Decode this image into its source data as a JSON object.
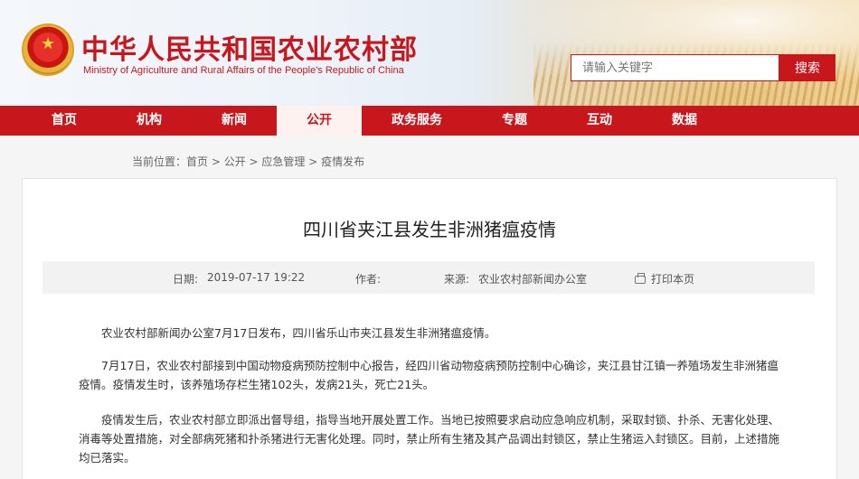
{
  "header": {
    "site_title": "中华人民共和国农业农村部",
    "site_subtitle": "Ministry of Agriculture and Rural Affairs of the People's Republic of China",
    "search_placeholder": "请输入关键字",
    "search_button": "搜索"
  },
  "nav": {
    "items": [
      {
        "label": "首页"
      },
      {
        "label": "机构"
      },
      {
        "label": "新闻"
      },
      {
        "label": "公开"
      },
      {
        "label": "政务服务"
      },
      {
        "label": "专题"
      },
      {
        "label": "互动"
      },
      {
        "label": "数据"
      }
    ],
    "active_index": 3
  },
  "breadcrumb": {
    "prefix": "当前位置：",
    "items": [
      "首页",
      "公开",
      "应急管理",
      "疫情发布"
    ],
    "separator": " > "
  },
  "article": {
    "title": "四川省夹江县发生非洲猪瘟疫情",
    "date_label": "日期:",
    "date": "2019-07-17 19:22",
    "author_label": "作者:",
    "author": "",
    "source_label": "来源:",
    "source": "农业农村部新闻办公室",
    "print_label": "打印本页",
    "paragraphs": [
      "农业农村部新闻办公室7月17日发布，四川省乐山市夹江县发生非洲猪瘟疫情。",
      "7月17日，农业农村部接到中国动物疫病预防控制中心报告，经四川省动物疫病预防控制中心确诊，夹江县甘江镇一养殖场发生非洲猪瘟疫情。疫情发生时，该养殖场存栏生猪102头，发病21头，死亡21头。",
      "疫情发生后，农业农村部立即派出督导组，指导当地开展处置工作。当地已按照要求启动应急响应机制，采取封锁、扑杀、无害化处理、消毒等处置措施，对全部病死猪和扑杀猪进行无害化处理。同时，禁止所有生猪及其产品调出封锁区，禁止生猪运入封锁区。目前，上述措施均已落实。"
    ]
  },
  "colors": {
    "brand_red": "#c8161d",
    "meta_bg": "#f2f2f2"
  }
}
